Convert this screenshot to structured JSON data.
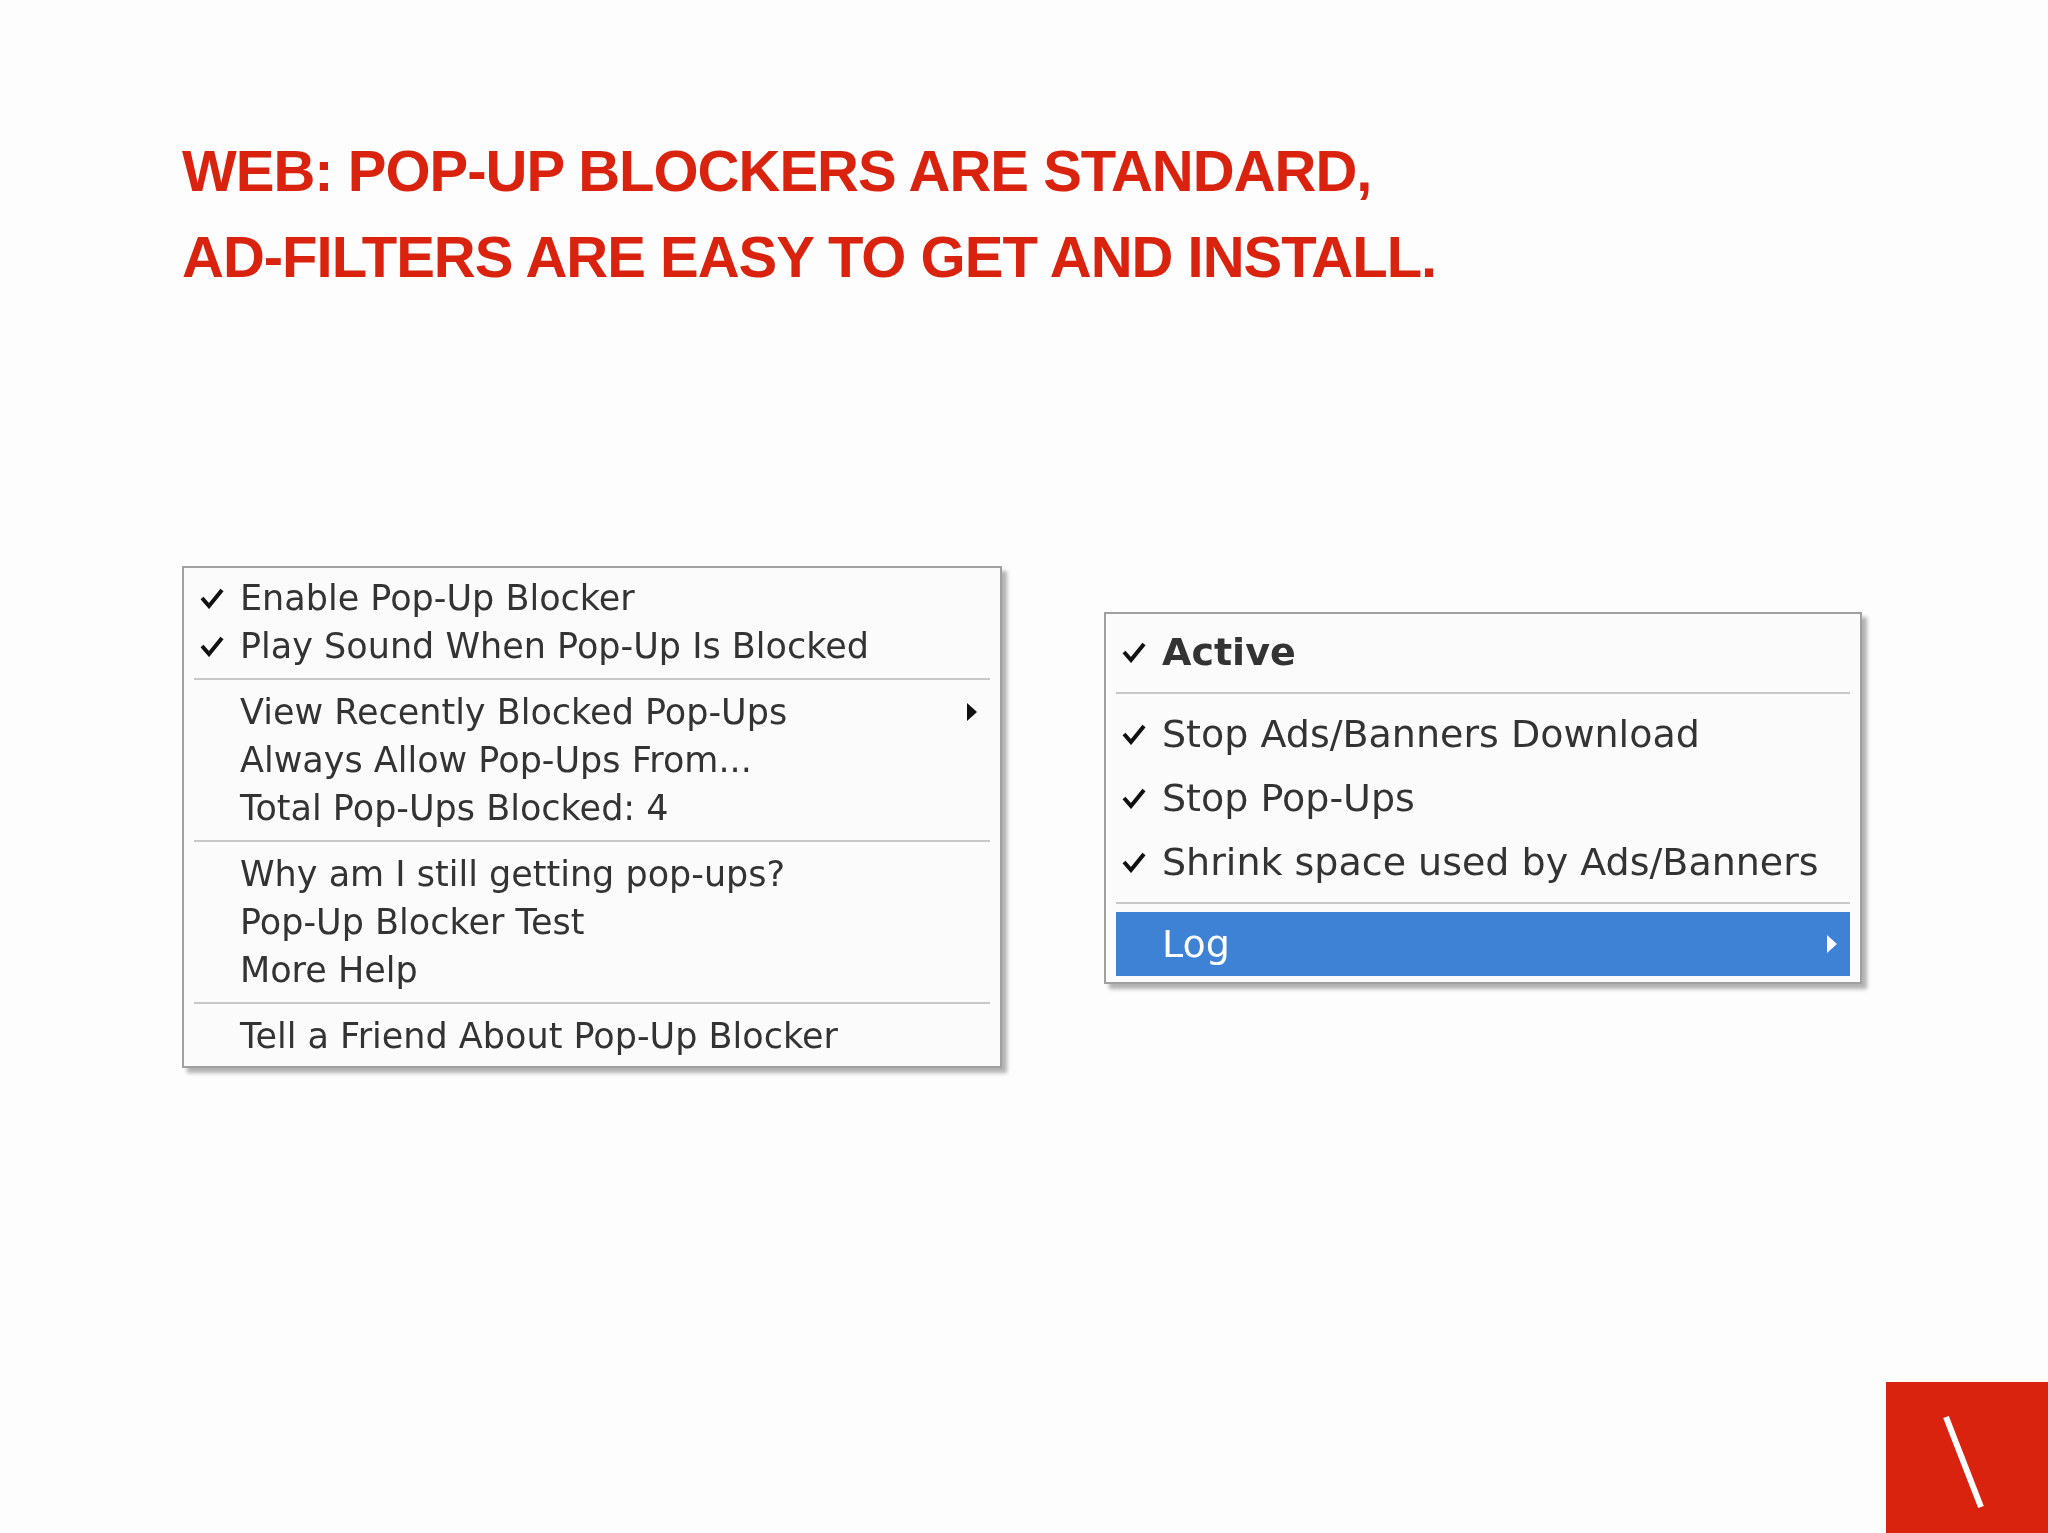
{
  "title_lines": [
    "WEB: POP-UP BLOCKERS ARE STANDARD,",
    "AD-FILTERS ARE EASY TO GET AND INSTALL."
  ],
  "menus": [
    {
      "sections": [
        [
          {
            "label": "Enable Pop-Up Blocker",
            "checked": true,
            "submenu": false,
            "selected": false,
            "kind": "normal"
          },
          {
            "label": "Play Sound When Pop-Up Is Blocked",
            "checked": true,
            "submenu": false,
            "selected": false,
            "kind": "normal"
          }
        ],
        [
          {
            "label": "View Recently Blocked Pop-Ups",
            "checked": false,
            "submenu": true,
            "selected": false,
            "kind": "normal"
          },
          {
            "label": "Always Allow Pop-Ups From...",
            "checked": false,
            "submenu": false,
            "selected": false,
            "kind": "normal"
          },
          {
            "label": "Total Pop-Ups Blocked: 4",
            "checked": false,
            "submenu": false,
            "selected": false,
            "kind": "normal"
          }
        ],
        [
          {
            "label": "Why am I still getting pop-ups?",
            "checked": false,
            "submenu": false,
            "selected": false,
            "kind": "normal"
          },
          {
            "label": "Pop-Up Blocker Test",
            "checked": false,
            "submenu": false,
            "selected": false,
            "kind": "normal"
          },
          {
            "label": "More Help",
            "checked": false,
            "submenu": false,
            "selected": false,
            "kind": "normal"
          }
        ],
        [
          {
            "label": "Tell a Friend About Pop-Up Blocker",
            "checked": false,
            "submenu": false,
            "selected": false,
            "kind": "normal"
          }
        ]
      ]
    },
    {
      "sections": [
        [
          {
            "label": "Active",
            "checked": true,
            "submenu": false,
            "selected": false,
            "kind": "default"
          }
        ],
        [
          {
            "label": "Stop Ads/Banners Download",
            "checked": true,
            "submenu": false,
            "selected": false,
            "kind": "normal"
          },
          {
            "label": "Stop Pop-Ups",
            "checked": true,
            "submenu": false,
            "selected": false,
            "kind": "normal"
          },
          {
            "label": "Shrink space used by Ads/Banners",
            "checked": true,
            "submenu": false,
            "selected": false,
            "kind": "normal"
          }
        ],
        [
          {
            "label": "Log",
            "checked": false,
            "submenu": true,
            "selected": true,
            "kind": "normal"
          }
        ]
      ]
    }
  ]
}
